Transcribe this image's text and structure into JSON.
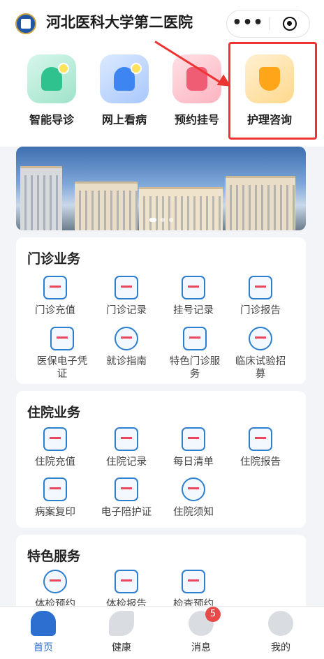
{
  "header": {
    "title": "河北医科大学第二医院",
    "more_glyph": "•••"
  },
  "quick_entries": [
    {
      "label": "智能导诊",
      "icon": "smart-guide-icon",
      "color": "#2fc28f"
    },
    {
      "label": "网上看病",
      "icon": "online-consult-icon",
      "color": "#3d86f2"
    },
    {
      "label": "预约挂号",
      "icon": "calendar-icon",
      "color": "#ef5d74"
    },
    {
      "label": "护理咨询",
      "icon": "nursing-heart-icon",
      "color": "#ffa51a"
    }
  ],
  "sections": {
    "outpatient": {
      "title": "门诊业务",
      "items": [
        {
          "label": "门诊充值",
          "icon": "recharge-icon"
        },
        {
          "label": "门诊记录",
          "icon": "record-icon"
        },
        {
          "label": "挂号记录",
          "icon": "register-record-icon"
        },
        {
          "label": "门诊报告",
          "icon": "report-icon"
        },
        {
          "label": "医保电子凭证",
          "icon": "chs-icon"
        },
        {
          "label": "就诊指南",
          "icon": "compass-icon"
        },
        {
          "label": "特色门诊服务",
          "icon": "special-clinic-icon"
        },
        {
          "label": "临床试验招募",
          "icon": "add-person-icon"
        }
      ]
    },
    "inpatient": {
      "title": "住院业务",
      "items": [
        {
          "label": "住院充值",
          "icon": "recharge-icon"
        },
        {
          "label": "住院记录",
          "icon": "record-icon"
        },
        {
          "label": "每日清单",
          "icon": "checklist-icon"
        },
        {
          "label": "住院报告",
          "icon": "report-icon"
        },
        {
          "label": "病案复印",
          "icon": "printer-icon"
        },
        {
          "label": "电子陪护证",
          "icon": "heart-card-icon"
        },
        {
          "label": "住院须知",
          "icon": "info-icon"
        }
      ]
    },
    "special": {
      "title": "特色服务",
      "items": [
        {
          "label": "体检预约",
          "icon": "stethoscope-icon"
        },
        {
          "label": "体检报告",
          "icon": "report-icon"
        },
        {
          "label": "检查预约",
          "icon": "clock-doc-icon"
        }
      ]
    }
  },
  "tabbar": [
    {
      "label": "首页",
      "icon": "home-icon",
      "active": true
    },
    {
      "label": "健康",
      "icon": "leaf-icon",
      "active": false
    },
    {
      "label": "消息",
      "icon": "message-icon",
      "active": false,
      "badge": "5"
    },
    {
      "label": "我的",
      "icon": "profile-icon",
      "active": false
    }
  ],
  "colors": {
    "accent": "#2d6fd0",
    "highlight": "#e33333",
    "badge": "#e84a4a"
  }
}
